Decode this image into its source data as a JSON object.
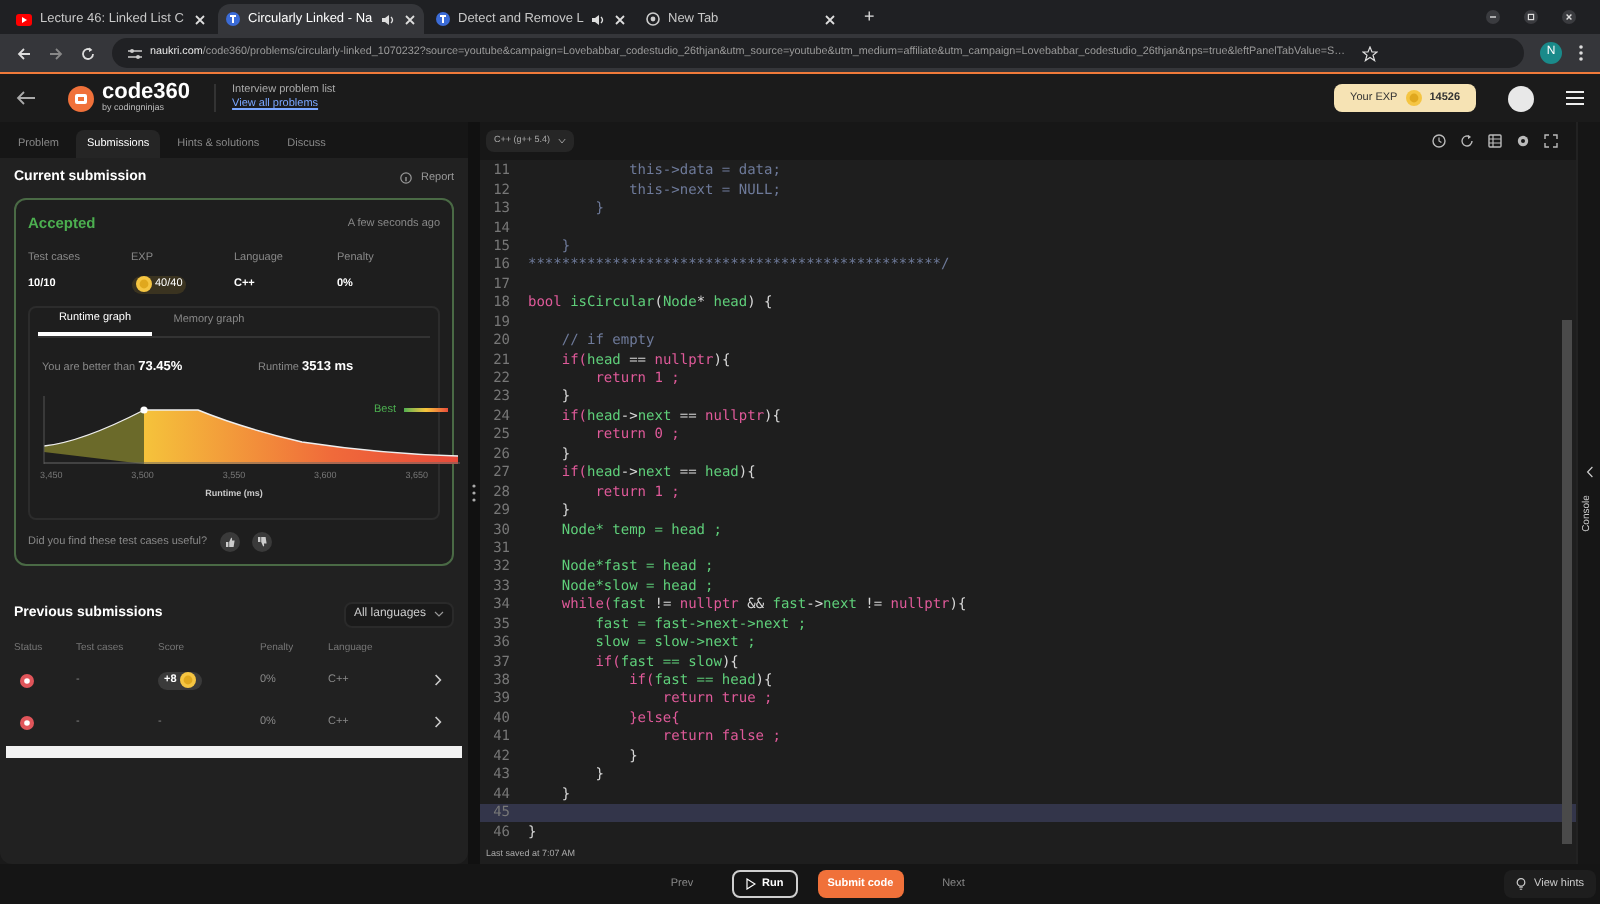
{
  "browser": {
    "tabs": [
      {
        "title": "Lecture 46: Linked List C",
        "kind": "youtube",
        "audio": false,
        "selected": false
      },
      {
        "title": "Circularly Linked - Na",
        "kind": "site",
        "audio": true,
        "selected": true
      },
      {
        "title": "Detect and Remove L",
        "kind": "site",
        "audio": true,
        "selected": false
      },
      {
        "title": "New Tab",
        "kind": "chrome",
        "audio": false,
        "selected": false
      }
    ],
    "new_tab": "+",
    "url_host": "naukri.com",
    "url_path": "/code360/problems/circularly-linked_1070232?source=youtube&campaign=Lovebabbar_codestudio_26thjan&utm_source=youtube&utm_medium=affiliate&utm_campaign=Lovebabbar_codestudio_26thjan&nps=true&leftPanelTabValue=S…",
    "profile": "N"
  },
  "header": {
    "logo": "code360",
    "logo_sub": "by codingninjas",
    "nav_title": "Interview problem list",
    "nav_link": "View all problems",
    "exp_label": "Your EXP",
    "exp_value": "14526"
  },
  "left_tabs": [
    {
      "label": "Problem",
      "selected": false
    },
    {
      "label": "Submissions",
      "selected": true
    },
    {
      "label": "Hints & solutions",
      "selected": false
    },
    {
      "label": "Discuss",
      "selected": false
    }
  ],
  "current_submission": {
    "title": "Current submission",
    "report": "Report",
    "status": "Accepted",
    "time": "A few seconds ago",
    "stats": [
      {
        "label": "Test cases",
        "value": "10/10",
        "kind": "text"
      },
      {
        "label": "EXP",
        "value": "40/40",
        "kind": "coin"
      },
      {
        "label": "Language",
        "value": "C++",
        "kind": "text"
      },
      {
        "label": "Penalty",
        "value": "0%",
        "kind": "text"
      }
    ],
    "graph_tabs": [
      {
        "label": "Runtime graph",
        "selected": true
      },
      {
        "label": "Memory graph",
        "selected": false
      }
    ],
    "better_label": "You are better than",
    "better_value": "73.45%",
    "runtime_label": "Runtime",
    "runtime_value": "3513 ms",
    "legend": "Best",
    "x_ticks": [
      "3,450",
      "3,500",
      "3,550",
      "3,600",
      "3,650"
    ],
    "xlabel": "Runtime (ms)",
    "feedback": "Did you find these test cases useful?"
  },
  "previous_submissions": {
    "title": "Previous submissions",
    "filter": "All languages",
    "columns": [
      "Status",
      "Test cases",
      "Score",
      "Penalty",
      "Language"
    ],
    "rows": [
      {
        "failed": true,
        "test_cases": "-",
        "score": "+8",
        "score_coin": true,
        "penalty": "0%",
        "language": "C++"
      },
      {
        "failed": true,
        "test_cases": "-",
        "score": "-",
        "score_coin": false,
        "penalty": "0%",
        "language": "C++"
      }
    ]
  },
  "editor": {
    "language": "C++ (g++ 5.4)",
    "lines": [
      {
        "number": "11",
        "current": false,
        "segments": [
          {
            "text": "            this->data = data;",
            "kind": "comment"
          }
        ]
      },
      {
        "number": "12",
        "current": false,
        "segments": [
          {
            "text": "            this->next = NULL;",
            "kind": "comment"
          }
        ]
      },
      {
        "number": "13",
        "current": false,
        "segments": [
          {
            "text": "        }",
            "kind": "comment"
          }
        ]
      },
      {
        "number": "14",
        "current": false
      },
      {
        "number": "15",
        "current": false,
        "segments": [
          {
            "text": "    }",
            "kind": "comment"
          }
        ]
      },
      {
        "number": "16",
        "current": false,
        "segments": [
          {
            "text": "*************************************************/",
            "kind": "comment"
          }
        ]
      },
      {
        "number": "17",
        "current": false
      },
      {
        "number": "18",
        "current": false,
        "segments": [
          {
            "text": "bool ",
            "kind": "keyword"
          },
          {
            "text": "isCircular",
            "kind": "name"
          },
          {
            "text": "(",
            "kind": "plain"
          },
          {
            "text": "Node",
            "kind": "name"
          },
          {
            "text": "* ",
            "kind": "plain"
          },
          {
            "text": "head",
            "kind": "name"
          },
          {
            "text": ") {",
            "kind": "plain"
          }
        ]
      },
      {
        "number": "19",
        "current": false
      },
      {
        "number": "20",
        "current": false,
        "segments": [
          {
            "text": "    // if empty",
            "kind": "comment"
          }
        ]
      },
      {
        "number": "21",
        "current": false,
        "segments": [
          {
            "text": "    if(",
            "kind": "keyword"
          },
          {
            "text": "head",
            "kind": "name"
          },
          {
            "text": " == ",
            "kind": "plain"
          },
          {
            "text": "nullptr",
            "kind": "keyword"
          },
          {
            "text": "){",
            "kind": "plain"
          }
        ]
      },
      {
        "number": "22",
        "current": false,
        "segments": [
          {
            "text": "        return 1 ;",
            "kind": "keyword"
          }
        ]
      },
      {
        "number": "23",
        "current": false,
        "segments": [
          {
            "text": "    }",
            "kind": "plain"
          }
        ]
      },
      {
        "number": "24",
        "current": false,
        "segments": [
          {
            "text": "    if(",
            "kind": "keyword"
          },
          {
            "text": "head",
            "kind": "name"
          },
          {
            "text": "->",
            "kind": "plain"
          },
          {
            "text": "next",
            "kind": "name"
          },
          {
            "text": " == ",
            "kind": "plain"
          },
          {
            "text": "nullptr",
            "kind": "keyword"
          },
          {
            "text": "){",
            "kind": "plain"
          }
        ]
      },
      {
        "number": "25",
        "current": false,
        "segments": [
          {
            "text": "        return 0 ;",
            "kind": "keyword"
          }
        ]
      },
      {
        "number": "26",
        "current": false,
        "segments": [
          {
            "text": "    }",
            "kind": "plain"
          }
        ]
      },
      {
        "number": "27",
        "current": false,
        "segments": [
          {
            "text": "    if(",
            "kind": "keyword"
          },
          {
            "text": "head",
            "kind": "name"
          },
          {
            "text": "->",
            "kind": "plain"
          },
          {
            "text": "next",
            "kind": "name"
          },
          {
            "text": " == ",
            "kind": "plain"
          },
          {
            "text": "head",
            "kind": "name"
          },
          {
            "text": "){",
            "kind": "plain"
          }
        ]
      },
      {
        "number": "28",
        "current": false,
        "segments": [
          {
            "text": "        return 1 ;",
            "kind": "keyword"
          }
        ]
      },
      {
        "number": "29",
        "current": false,
        "segments": [
          {
            "text": "    }",
            "kind": "plain"
          }
        ]
      },
      {
        "number": "30",
        "current": false,
        "segments": [
          {
            "text": "    Node* temp = head ;",
            "kind": "name"
          }
        ]
      },
      {
        "number": "31",
        "current": false
      },
      {
        "number": "32",
        "current": false,
        "segments": [
          {
            "text": "    Node*fast = head ;",
            "kind": "name"
          }
        ]
      },
      {
        "number": "33",
        "current": false,
        "segments": [
          {
            "text": "    Node*slow = head ;",
            "kind": "name"
          }
        ]
      },
      {
        "number": "34",
        "current": false,
        "segments": [
          {
            "text": "    while(",
            "kind": "keyword"
          },
          {
            "text": "fast",
            "kind": "name"
          },
          {
            "text": " != ",
            "kind": "plain"
          },
          {
            "text": "nullptr",
            "kind": "keyword"
          },
          {
            "text": " && ",
            "kind": "plain"
          },
          {
            "text": "fast",
            "kind": "name"
          },
          {
            "text": "->",
            "kind": "plain"
          },
          {
            "text": "next",
            "kind": "name"
          },
          {
            "text": " != ",
            "kind": "plain"
          },
          {
            "text": "nullptr",
            "kind": "keyword"
          },
          {
            "text": "){",
            "kind": "plain"
          }
        ]
      },
      {
        "number": "35",
        "current": false,
        "segments": [
          {
            "text": "        fast = fast->next->next ;",
            "kind": "name"
          }
        ]
      },
      {
        "number": "36",
        "current": false,
        "segments": [
          {
            "text": "        slow = slow->next ;",
            "kind": "name"
          }
        ]
      },
      {
        "number": "37",
        "current": false,
        "segments": [
          {
            "text": "        if(",
            "kind": "keyword"
          },
          {
            "text": "fast == slow",
            "kind": "name"
          },
          {
            "text": "){",
            "kind": "plain"
          }
        ]
      },
      {
        "number": "38",
        "current": false,
        "segments": [
          {
            "text": "            if(",
            "kind": "keyword"
          },
          {
            "text": "fast == head",
            "kind": "name"
          },
          {
            "text": "){",
            "kind": "plain"
          }
        ]
      },
      {
        "number": "39",
        "current": false,
        "segments": [
          {
            "text": "                return true ;",
            "kind": "keyword"
          }
        ]
      },
      {
        "number": "40",
        "current": false,
        "segments": [
          {
            "text": "            }else{",
            "kind": "keyword"
          }
        ]
      },
      {
        "number": "41",
        "current": false,
        "segments": [
          {
            "text": "                return false ;",
            "kind": "keyword"
          }
        ]
      },
      {
        "number": "42",
        "current": false,
        "segments": [
          {
            "text": "            }",
            "kind": "plain"
          }
        ]
      },
      {
        "number": "43",
        "current": false,
        "segments": [
          {
            "text": "        }",
            "kind": "plain"
          }
        ]
      },
      {
        "number": "44",
        "current": false,
        "segments": [
          {
            "text": "    }",
            "kind": "plain"
          }
        ]
      },
      {
        "number": "45",
        "current": true
      },
      {
        "number": "46",
        "current": false,
        "segments": [
          {
            "text": "}",
            "kind": "plain"
          }
        ]
      }
    ],
    "last_saved": "Last saved at 7:07 AM",
    "console": "Console"
  },
  "footer": {
    "prev": "Prev",
    "run": "Run",
    "submit": "Submit code",
    "next": "Next",
    "hints": "View hints"
  }
}
